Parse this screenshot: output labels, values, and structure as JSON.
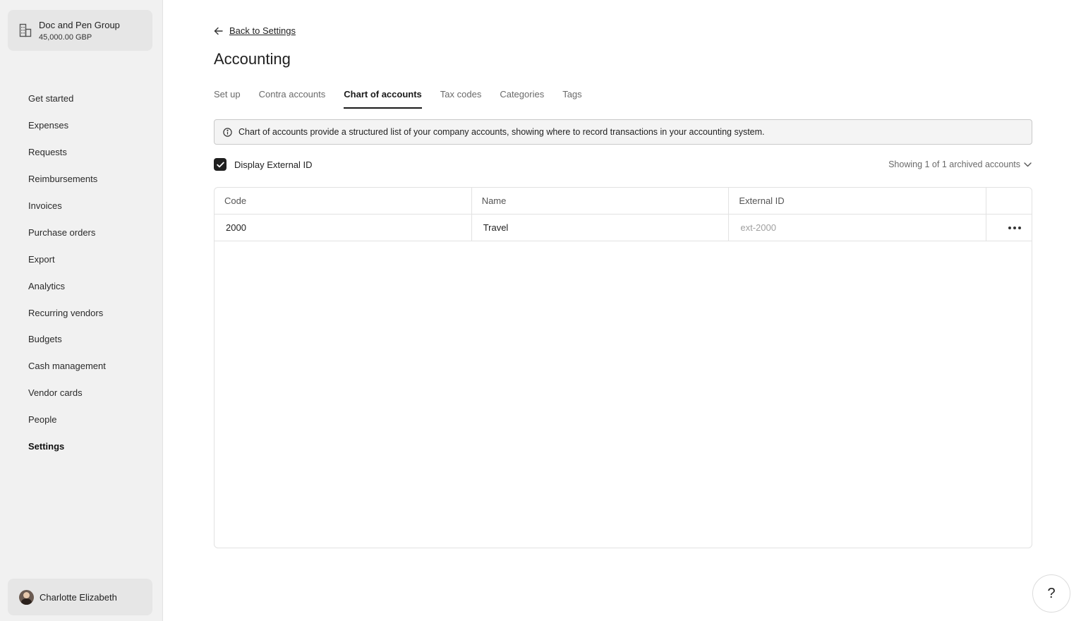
{
  "sidebar": {
    "company": {
      "name": "Doc and Pen Group",
      "balance": "45,000.00 GBP",
      "icon": "building-icon"
    },
    "items": [
      {
        "label": "Get started",
        "active": false
      },
      {
        "label": "Expenses",
        "active": false
      },
      {
        "label": "Requests",
        "active": false
      },
      {
        "label": "Reimbursements",
        "active": false
      },
      {
        "label": "Invoices",
        "active": false
      },
      {
        "label": "Purchase orders",
        "active": false
      },
      {
        "label": "Export",
        "active": false
      },
      {
        "label": "Analytics",
        "active": false
      },
      {
        "label": "Recurring vendors",
        "active": false
      },
      {
        "label": "Budgets",
        "active": false
      },
      {
        "label": "Cash management",
        "active": false
      },
      {
        "label": "Vendor cards",
        "active": false
      },
      {
        "label": "People",
        "active": false
      },
      {
        "label": "Settings",
        "active": true
      }
    ],
    "user": {
      "name": "Charlotte Elizabeth"
    }
  },
  "main": {
    "back_label": "Back to Settings",
    "title": "Accounting",
    "tabs": [
      {
        "label": "Set up",
        "active": false
      },
      {
        "label": "Contra accounts",
        "active": false
      },
      {
        "label": "Chart of accounts",
        "active": true
      },
      {
        "label": "Tax codes",
        "active": false
      },
      {
        "label": "Categories",
        "active": false
      },
      {
        "label": "Tags",
        "active": false
      }
    ],
    "info_text": "Chart of accounts provide a structured list of your company accounts, showing where to record transactions in your accounting system.",
    "display_external_id": {
      "label": "Display External ID",
      "checked": true
    },
    "archived_label": "Showing 1 of 1 archived accounts",
    "table": {
      "columns": [
        "Code",
        "Name",
        "External ID"
      ],
      "rows": [
        {
          "code": "2000",
          "name": "Travel",
          "external_id": "ext-2000"
        }
      ]
    },
    "help_label": "?"
  },
  "colors": {
    "sidebar_bg": "#f1f1f1",
    "accent": "#1f1f1f",
    "muted": "#6a6a6a"
  }
}
